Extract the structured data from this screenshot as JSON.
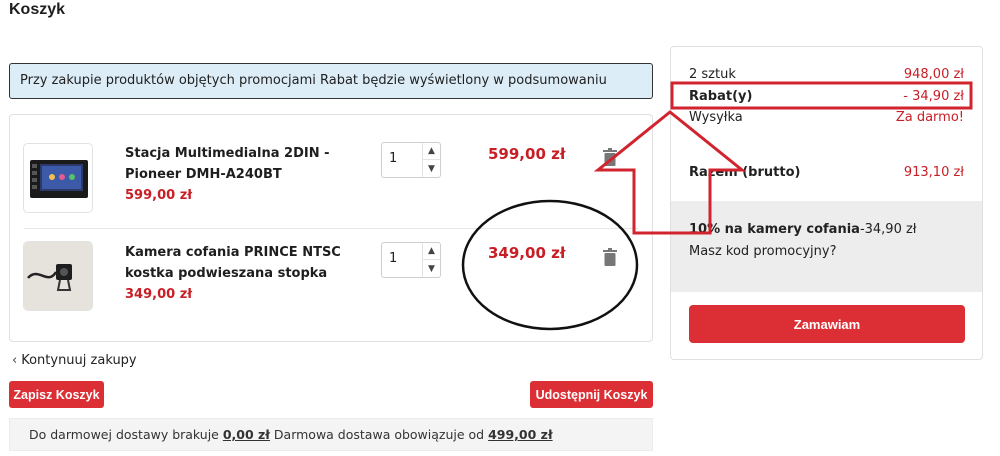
{
  "page": {
    "title": "Koszyk"
  },
  "promo_banner": {
    "text": "Przy zakupie produktów objętych promocjami Rabat będzie wyświetlony w podsumowaniu"
  },
  "cart": {
    "items": [
      {
        "name": "Stacja Multimedialna 2DIN - Pioneer DMH-A240BT",
        "unit_price": "599,00 zł",
        "quantity": "1",
        "line_total": "599,00 zł",
        "thumbnail": "car-radio-image"
      },
      {
        "name": "Kamera cofania PRINCE NTSC kostka podwieszana stopka",
        "unit_price": "349,00 zł",
        "quantity": "1",
        "line_total": "349,00 zł",
        "thumbnail": "rear-camera-image"
      }
    ],
    "continue_label": "Kontynuuj zakupy",
    "save_label": "Zapisz Koszyk",
    "share_label": "Udostępnij Koszyk"
  },
  "shipping": {
    "prefix": "Do darmowej dostawy brakuje ",
    "missing_amount": "0,00 zł",
    "middle": " Darmowa dostawa obowiązuje od ",
    "threshold": "499,00 zł"
  },
  "summary": {
    "items_label": "2 sztuk",
    "items_value": "948,00 zł",
    "discount_label": "Rabat(y)",
    "discount_value": "- 34,90 zł",
    "shipping_label": "Wysyłka",
    "shipping_value": "Za darmo!",
    "total_label": "Razem (brutto)",
    "total_value": "913,10 zł",
    "promo_name": "10% na kamery cofania",
    "promo_value": "-34,90 zł",
    "promo_code_question": "Masz kod promocyjny?",
    "order_label": "Zamawiam"
  },
  "colors": {
    "accent": "#dc2f35",
    "price": "#c81e25",
    "banner_bg": "#dcedf7",
    "annotation": "#d1242f"
  }
}
